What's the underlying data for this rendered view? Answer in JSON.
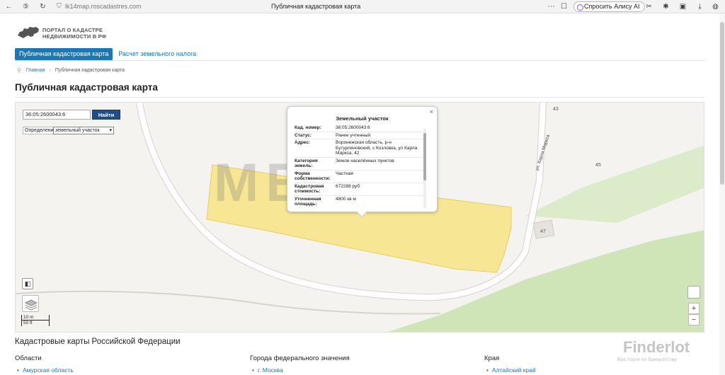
{
  "browser": {
    "url": "lk14map.roscadastres.com",
    "tab_title": "Публичная кадастровая карта",
    "alice_button": "Спросить Алису AI"
  },
  "header": {
    "logo_line1": "ПОРТАЛ О КАДАСТРЕ",
    "logo_line2": "НЕДВИЖИМОСТИ В РФ"
  },
  "topnav": {
    "active_tab": "Публичная кадастровая карта",
    "second_tab": "Расчет земельного налога"
  },
  "breadcrumb": {
    "home": "Главная",
    "current": "Публичная кадастровая карта"
  },
  "page_title": "Публичная кадастровая карта",
  "map": {
    "search_value": "36:05:2600043:6",
    "search_button": "Найти",
    "definition_label": "Определение:",
    "definition_value": "земельный участок",
    "house_numbers": {
      "h43": "43",
      "h45": "45",
      "h47": "47"
    },
    "street_name": "ул. Карла Маркса",
    "scale_m": "10 m",
    "scale_ft": "50 ft",
    "watermark": "МЕТСА",
    "colors": {
      "parcel_fill": "#f7e58a",
      "green": "#cfe5b8",
      "road": "#ffffff"
    }
  },
  "popup": {
    "title": "Земельный участок",
    "rows": [
      {
        "k": "Кад. номер:",
        "v": "36:05:2600043:6"
      },
      {
        "k": "Статус:",
        "v": "Ранее учтенный"
      },
      {
        "k": "Адрес:",
        "v": "Воронежская область, р-н Бутурлиновский, с Козловка, ул Карла Маркса, 42"
      },
      {
        "k": "Категория земель:",
        "v": "Земли населённых пунктов"
      },
      {
        "k": "Форма собственности:",
        "v": "Частная"
      },
      {
        "k": "Кадастровая стоимость:",
        "v": "672288 руб"
      },
      {
        "k": "Уточненная площадь:",
        "v": "4800 кв м"
      }
    ]
  },
  "regions": {
    "title": "Кадастровые карты Российской Федерации",
    "columns": [
      {
        "head": "Области",
        "first": "Амурская область"
      },
      {
        "head": "Города федерального значения",
        "first": "г. Москва"
      },
      {
        "head": "Края",
        "first": "Алтайский край"
      }
    ]
  },
  "finderlot": {
    "logo": "Finderlot",
    "sub": "Все торги по банкротству"
  }
}
